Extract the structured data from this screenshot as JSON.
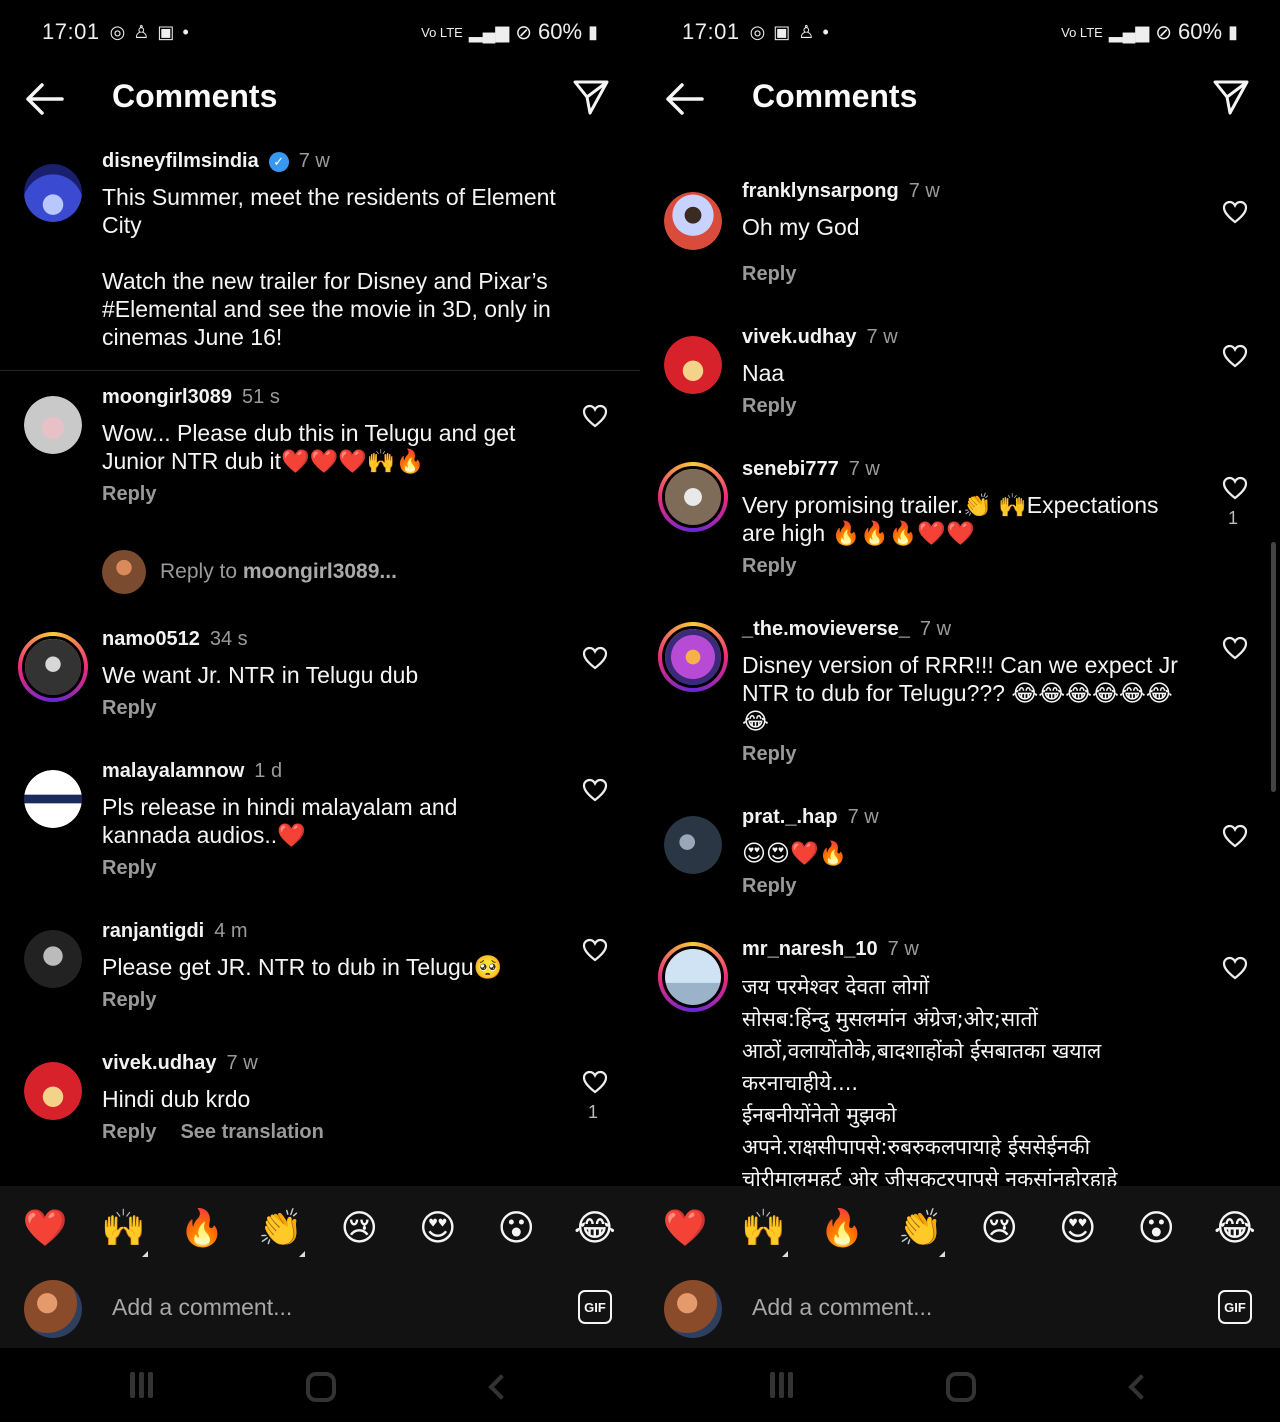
{
  "status": {
    "time": "17:01",
    "battery": "60%"
  },
  "left": {
    "header": {
      "title": "Comments"
    },
    "caption": {
      "user": "disneyfilmsindia",
      "time": "7 w",
      "line1": "This Summer, meet the residents of Element City",
      "line2": "Watch the new trailer for Disney and Pixar’s #Elemental and see the movie in 3D, only in cinemas June 16!"
    },
    "comments": [
      {
        "user": "moongirl3089",
        "time": "51 s",
        "text": "Wow... Please dub this in Telugu and get Junior NTR dub it❤️❤️❤️🙌🔥",
        "reply": "Reply"
      },
      {
        "user": "namo0512",
        "time": "34 s",
        "text": "We want Jr. NTR in Telugu dub",
        "reply": "Reply"
      },
      {
        "user": "malayalamnow",
        "time": "1 d",
        "text": "Pls release in hindi malayalam and kannada audios..❤️",
        "reply": "Reply"
      },
      {
        "user": "ranjantigdi",
        "time": "4 m",
        "text": "Please get JR. NTR to dub in Telugu🥺",
        "reply": "Reply"
      },
      {
        "user": "vivek.udhay",
        "time": "7 w",
        "text": "Hindi dub krdo",
        "reply": "Reply",
        "translate": "See translation",
        "likes": "1"
      }
    ],
    "reply_prompt": {
      "prefix": "Reply to ",
      "user": "moongirl3089..."
    },
    "composer": {
      "placeholder": "Add a comment...",
      "gif": "GIF"
    }
  },
  "right": {
    "header": {
      "title": "Comments"
    },
    "comments": [
      {
        "user": "franklynsarpong",
        "time": "7 w",
        "text": "Oh my God",
        "reply": "Reply"
      },
      {
        "user": "vivek.udhay",
        "time": "7 w",
        "text": "Naa",
        "reply": "Reply"
      },
      {
        "user": "senebi777",
        "time": "7 w",
        "text": "Very promising trailer.👏 🙌Expectations are high 🔥🔥🔥❤️❤️",
        "reply": "Reply",
        "likes": "1"
      },
      {
        "user": "_the.movieverse_",
        "time": "7 w",
        "text": "Disney version of RRR!!! Can we expect Jr NTR to dub for Telugu??? 😂😂😂😂😂😂 😂",
        "reply": "Reply"
      },
      {
        "user": "prat._.hap",
        "time": "7 w",
        "text": "😍😍❤️🔥",
        "reply": "Reply"
      },
      {
        "user": "mr_naresh_10",
        "time": "7 w",
        "text": "जय परमेश्वर देवता लोगों\nसोसब:हिंन्दु मुसलमांन अंग्रेज;ओर;सातों आठों,वलायोंतोके,बादशाहोंको ईसबातका खयाल करनाचाहीये....\nईनबनीयोंनेतो मुझको\nअपने.राक्षसीपापसे:रुबरुकलपायाहे ईससेईनकी चोरीमालमहर्ट ओर जीसकटरपापसे नकसांनहोरहाहे"
      }
    ],
    "composer": {
      "placeholder": "Add a comment...",
      "gif": "GIF"
    }
  },
  "emojis": [
    "❤️",
    "🙌",
    "🔥",
    "👏",
    "😢",
    "😍",
    "😮",
    "😂"
  ],
  "icons": {
    "back": "arrow-left-icon",
    "send": "paper-plane-icon",
    "heart": "heart-outline-icon"
  },
  "colors": {
    "background": "#000000",
    "bar": "#121212",
    "muted": "#9a9a9a",
    "verified": "#3897f0"
  }
}
